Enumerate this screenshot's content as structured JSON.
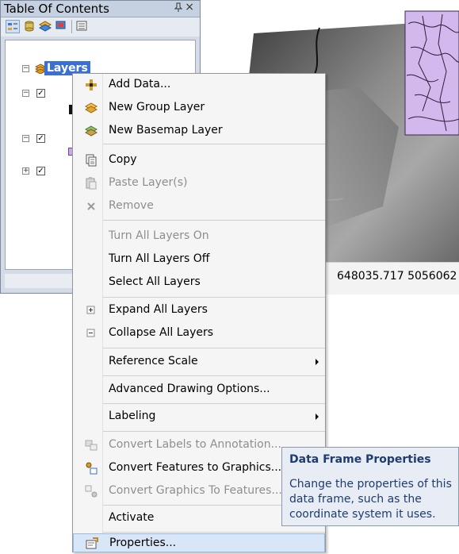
{
  "toc": {
    "title": "Table Of Contents",
    "pin_glyph": "ᵖ",
    "close_glyph": "×",
    "root_label": "Layers",
    "toolbar": [
      "list-by-drawing-order-icon",
      "list-by-source-icon",
      "list-by-visibility-icon",
      "list-by-selection-icon",
      "options-icon"
    ]
  },
  "map": {
    "coordinates": "648035.717  5056062"
  },
  "context_menu": {
    "items": [
      {
        "label": "Add Data...",
        "icon": "add-data-icon",
        "disabled": false
      },
      {
        "label": "New Group Layer",
        "icon": "new-group-layer-icon",
        "disabled": false
      },
      {
        "label": "New Basemap Layer",
        "icon": "new-basemap-layer-icon",
        "disabled": false
      },
      {
        "label": "Copy",
        "icon": "copy-icon",
        "disabled": false
      },
      {
        "label": "Paste Layer(s)",
        "icon": "paste-icon",
        "disabled": true
      },
      {
        "label": "Remove",
        "icon": "remove-icon",
        "disabled": true
      },
      {
        "label": "Turn All Layers On",
        "icon": "",
        "disabled": true
      },
      {
        "label": "Turn All Layers Off",
        "icon": "",
        "disabled": false
      },
      {
        "label": "Select All Layers",
        "icon": "",
        "disabled": false
      },
      {
        "label": "Expand All Layers",
        "icon": "expand-icon",
        "disabled": false
      },
      {
        "label": "Collapse All Layers",
        "icon": "collapse-icon",
        "disabled": false
      },
      {
        "label": "Reference Scale",
        "icon": "",
        "disabled": false,
        "submenu": true
      },
      {
        "label": "Advanced Drawing Options...",
        "icon": "",
        "disabled": false
      },
      {
        "label": "Labeling",
        "icon": "",
        "disabled": false,
        "submenu": true
      },
      {
        "label": "Convert Labels to Annotation...",
        "icon": "convert-labels-icon",
        "disabled": true
      },
      {
        "label": "Convert Features to Graphics...",
        "icon": "convert-features-icon",
        "disabled": false
      },
      {
        "label": "Convert Graphics To Features...",
        "icon": "convert-graphics-icon",
        "disabled": true
      },
      {
        "label": "Activate",
        "icon": "",
        "disabled": false
      },
      {
        "label": "Properties...",
        "icon": "properties-icon",
        "disabled": false,
        "highlighted": true
      }
    ]
  },
  "tooltip": {
    "title": "Data Frame Properties",
    "body": "Change the properties of this data frame, such as the coordinate system it uses."
  }
}
